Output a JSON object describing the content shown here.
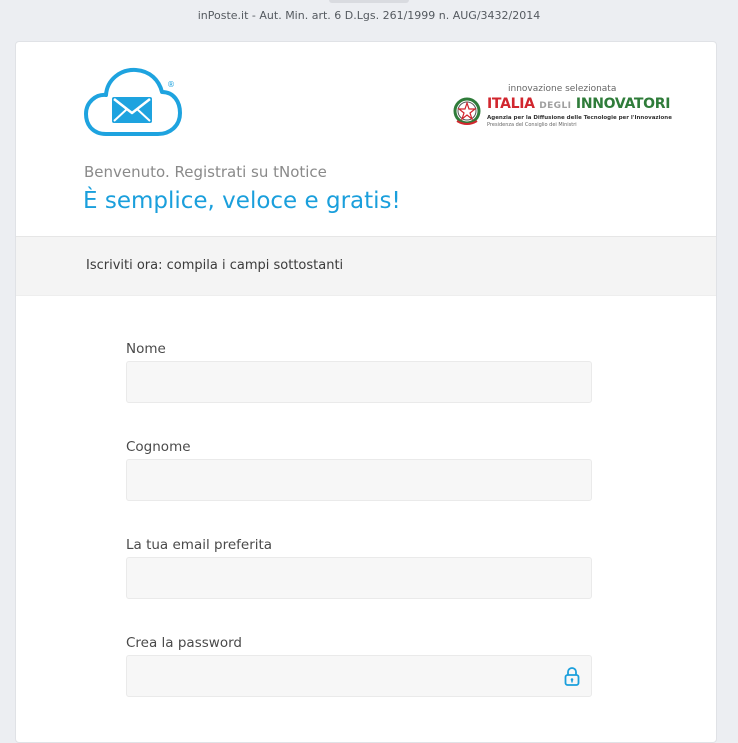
{
  "top_notice": "inPoste.it - Aut. Min. art. 6 D.Lgs. 261/1999 n. AUG/3432/2014",
  "logo": {
    "registered_mark": "®"
  },
  "innovation_badge": {
    "caption": "innovazione selezionata",
    "title_red": "ITALIA",
    "title_small": "DEGLI",
    "title_green": "INNOVATORI",
    "subtitle_line1": "Agenzia per la Diffusione delle Tecnologie per l'Innovazione",
    "subtitle_line2": "Presidenza del Consiglio dei Ministri"
  },
  "header": {
    "welcome": "Benvenuto. Registrati su tNotice",
    "tagline": "È semplice, veloce e gratis!"
  },
  "subbar": {
    "text": "Iscriviti ora: compila i campi sottostanti"
  },
  "form": {
    "fields": [
      {
        "label": "Nome",
        "value": "",
        "placeholder": ""
      },
      {
        "label": "Cognome",
        "value": "",
        "placeholder": ""
      },
      {
        "label": "La tua email preferita",
        "value": "",
        "placeholder": ""
      },
      {
        "label": "Crea la password",
        "value": "",
        "placeholder": ""
      }
    ]
  },
  "colors": {
    "brand_blue": "#1a9fdc",
    "italia_red": "#d1262e",
    "innovatori_green": "#2f7c3a"
  },
  "icons": {
    "logo": "cloud-mail-icon",
    "emblem": "italian-republic-emblem-icon",
    "password": "lock-icon"
  }
}
